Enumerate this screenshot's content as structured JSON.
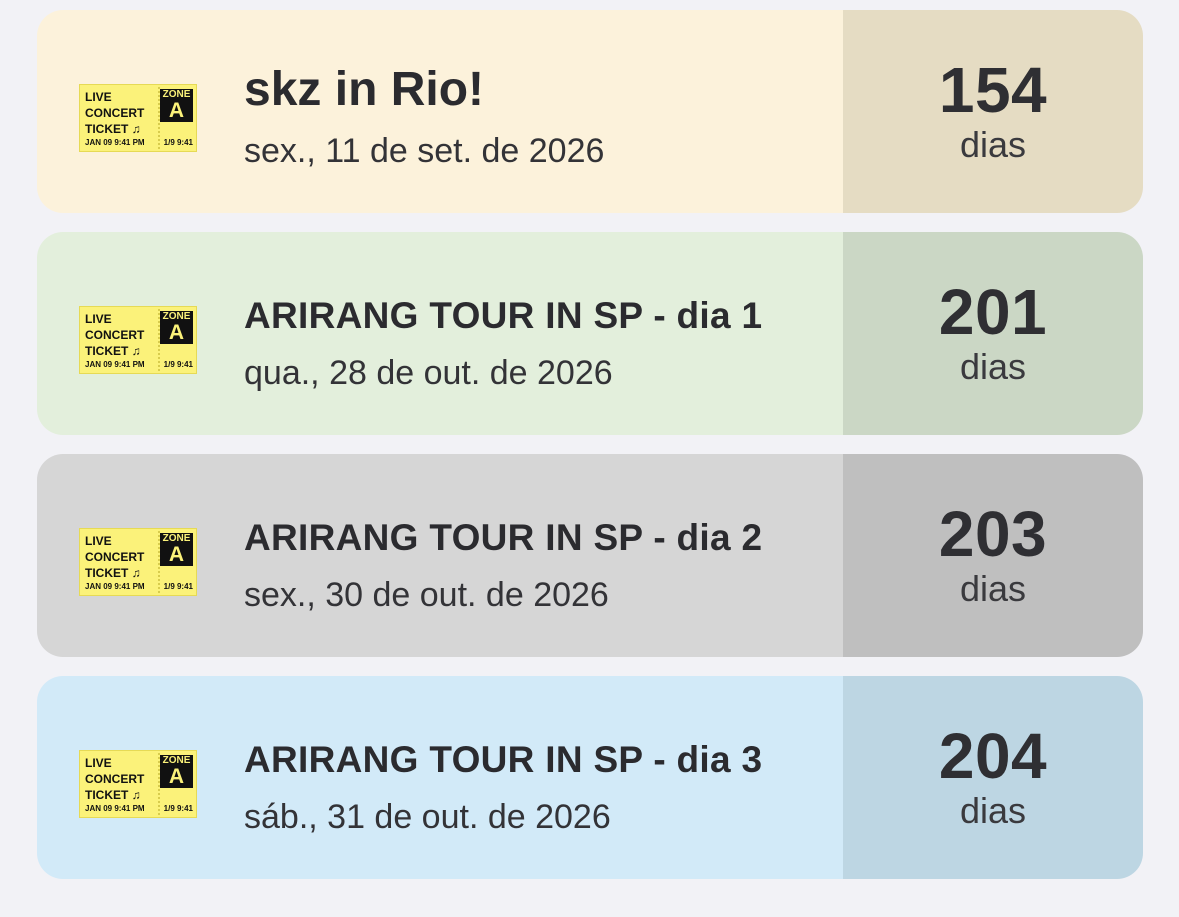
{
  "events": [
    {
      "title": "skz in Rio!",
      "date": "sex., 11 de set. de 2026",
      "count": "154",
      "unit": "dias",
      "colors": {
        "main": "#fcf2db",
        "side": "#e5dcc3"
      },
      "title_style": "big"
    },
    {
      "title": "ARIRANG TOUR IN SP - dia 1",
      "date": "qua., 28 de out. de 2026",
      "count": "201",
      "unit": "dias",
      "colors": {
        "main": "#e3efdc",
        "side": "#cbd7c5"
      },
      "title_style": "med"
    },
    {
      "title": "ARIRANG TOUR IN SP - dia 2",
      "date": "sex., 30 de out. de 2026",
      "count": "203",
      "unit": "dias",
      "colors": {
        "main": "#d6d6d6",
        "side": "#bfbfbf"
      },
      "title_style": "med"
    },
    {
      "title": "ARIRANG TOUR IN SP - dia 3",
      "date": "sáb., 31 de out. de 2026",
      "count": "204",
      "unit": "dias",
      "colors": {
        "main": "#d2eaf8",
        "side": "#bdd6e3"
      },
      "title_style": "med"
    }
  ],
  "ticket_icon": {
    "name": "concert-ticket-icon",
    "line1": "LIVE",
    "line2": "CONCERT",
    "line3": "TICKET ♫",
    "zone_label": "ZONE",
    "zone_letter": "A",
    "footer_left": "JAN 09   9:41 PM",
    "footer_right": "1/9  9:41"
  }
}
